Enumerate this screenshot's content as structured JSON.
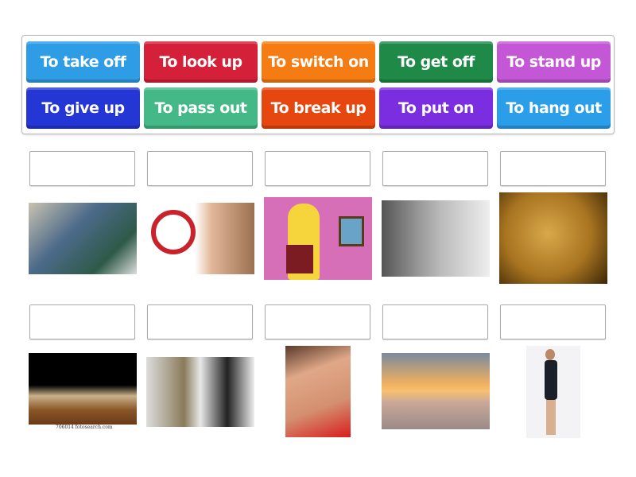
{
  "tiles": [
    {
      "label": "To take off",
      "color": "#2e9de6"
    },
    {
      "label": "To look up",
      "color": "#d42039"
    },
    {
      "label": "To switch on",
      "color": "#f47c12"
    },
    {
      "label": "To get off",
      "color": "#1f8a47"
    },
    {
      "label": "To stand up",
      "color": "#c457d5"
    },
    {
      "label": "To give up",
      "color": "#2436d3"
    },
    {
      "label": "To pass out",
      "color": "#44b987"
    },
    {
      "label": "To break up",
      "color": "#e5470f"
    },
    {
      "label": "To put on",
      "color": "#7a2ee0"
    },
    {
      "label": "To hang out",
      "color": "#2a9ee8"
    }
  ],
  "images": [
    {
      "alt": "friends-hanging-out"
    },
    {
      "alt": "no-smoking-woman"
    },
    {
      "alt": "homer-reading-book"
    },
    {
      "alt": "man-getting-off-train"
    },
    {
      "alt": "hand-on-light-switch"
    },
    {
      "alt": "woman-passed-out-at-table",
      "caption": "706014 fotosearch.com"
    },
    {
      "alt": "couple-broken-up"
    },
    {
      "alt": "woman-putting-on-lipstick"
    },
    {
      "alt": "plane-taking-off"
    },
    {
      "alt": "man-standing-up"
    }
  ]
}
